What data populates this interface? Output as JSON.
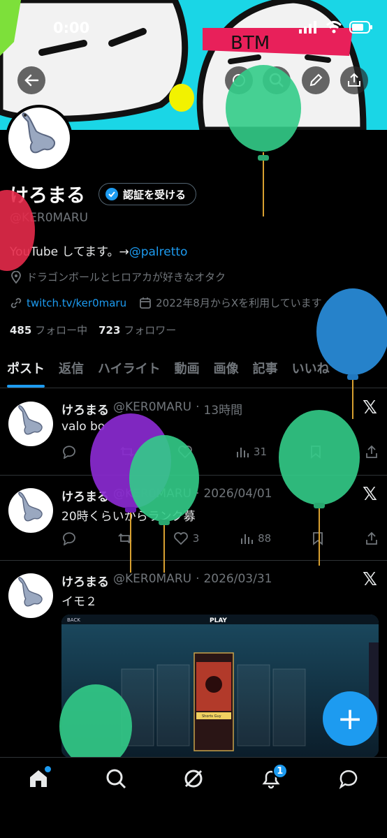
{
  "status": {
    "time": "0:00"
  },
  "banner": {
    "headband_text": "BTM"
  },
  "profile": {
    "name": "けろまる",
    "verify_label": "認証を受ける",
    "handle": "@KER0MARU",
    "bio_text": "YouTube してます。→",
    "bio_link": "@palretto",
    "location": "ドラゴンボールとヒロアカが好きなオタク",
    "website": "twitch.tv/ker0maru",
    "joined": "2022年8月からXを利用しています",
    "following_count": "485",
    "following_label": "フォロー中",
    "followers_count": "723",
    "followers_label": "フォロワー"
  },
  "tabs": [
    {
      "label": "ポスト"
    },
    {
      "label": "返信"
    },
    {
      "label": "ハイライト"
    },
    {
      "label": "動画"
    },
    {
      "label": "画像"
    },
    {
      "label": "記事"
    },
    {
      "label": "いいね"
    }
  ],
  "posts": [
    {
      "name": "けろまる",
      "handle": "@KER0MARU",
      "time": "13時間",
      "text": "valo bo",
      "likes": "",
      "views": "31"
    },
    {
      "name": "けろまる",
      "handle": "@KER0MARU",
      "time": "2026/04/01",
      "text": "20時くらいからランク募",
      "likes": "3",
      "views": "88"
    },
    {
      "name": "けろまる",
      "handle": "@KER0MARU",
      "time": "2026/03/31",
      "text": "イモ２"
    }
  ],
  "media": {
    "header_label": "PLAY",
    "back_label": "BACK",
    "card_label": "Shorts Guy"
  },
  "fab": {
    "label": "+"
  },
  "nav": {
    "notification_badge": "1"
  },
  "colors": {
    "accent": "#1d9bf0",
    "background": "#000000",
    "muted": "#71767b"
  }
}
